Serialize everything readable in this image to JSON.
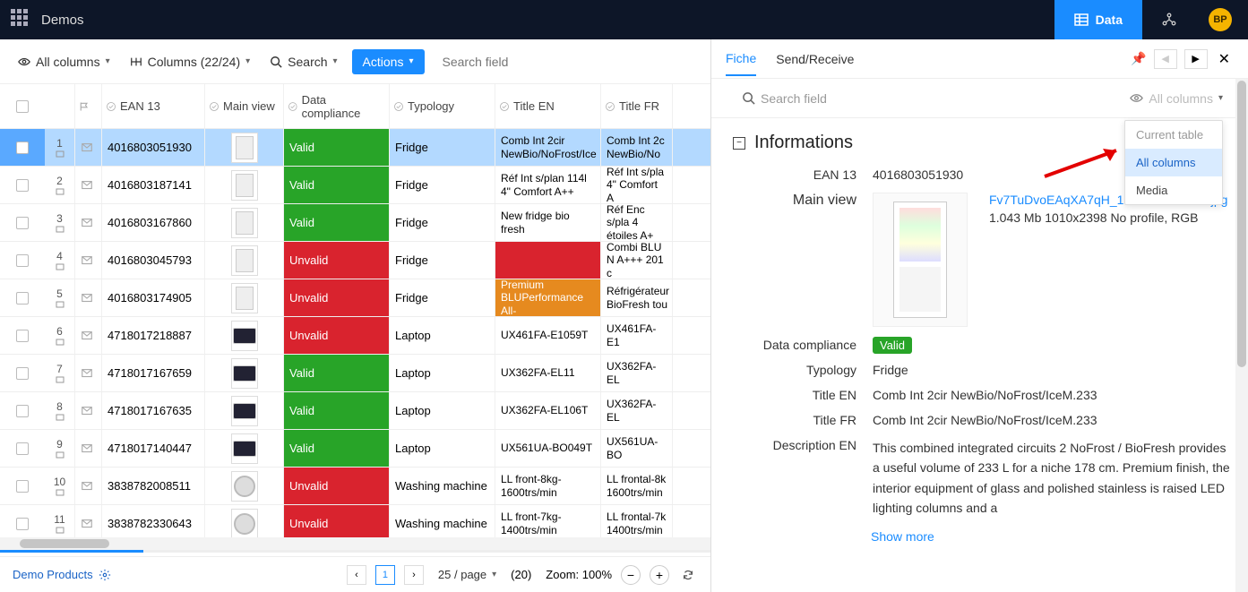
{
  "header": {
    "app": "Demos",
    "tabs": {
      "data": "Data"
    },
    "avatar": "BP"
  },
  "toolbar": {
    "allcols": "All columns",
    "columns": "Columns (22/24)",
    "search": "Search",
    "actions": "Actions",
    "search_ph": "Search field"
  },
  "grid_head": {
    "ean": "EAN 13",
    "main_view": "Main view",
    "compliance": "Data compliance",
    "typology": "Typology",
    "title_en": "Title EN",
    "title_fr": "Title FR"
  },
  "rows": [
    {
      "idx": "1",
      "ean": "4016803051930",
      "comp": "Valid",
      "typ": "Fridge",
      "en": "Comb Int 2cir NewBio/NoFrost/Ice",
      "fr": "Comb Int 2c NewBio/No",
      "thumb": "fridge",
      "sel": true
    },
    {
      "idx": "2",
      "ean": "4016803187141",
      "comp": "Valid",
      "typ": "Fridge",
      "en": "Réf Int s/plan 114l 4\" Comfort A++",
      "fr": "Réf Int s/pla 4\" Comfort A",
      "thumb": "fridge"
    },
    {
      "idx": "3",
      "ean": "4016803167860",
      "comp": "Valid",
      "typ": "Fridge",
      "en": "New fridge bio fresh",
      "fr": "Réf Enc s/pla 4 étoiles A+",
      "thumb": "fridge"
    },
    {
      "idx": "4",
      "ean": "4016803045793",
      "comp": "Unvalid",
      "typ": "Fridge",
      "en": "",
      "fr": "Combi BLU N A+++ 201 c",
      "thumb": "fridge",
      "en_bg": "red"
    },
    {
      "idx": "5",
      "ean": "4016803174905",
      "comp": "Unvalid",
      "typ": "Fridge",
      "en": "Premium BLUPerformance All-",
      "fr": "Réfrigérateur BioFresh tou",
      "thumb": "fridge",
      "en_bg": "orange"
    },
    {
      "idx": "6",
      "ean": "4718017218887",
      "comp": "Unvalid",
      "typ": "Laptop",
      "en": "UX461FA-E1059T",
      "fr": "UX461FA-E1",
      "thumb": "laptop"
    },
    {
      "idx": "7",
      "ean": "4718017167659",
      "comp": "Valid",
      "typ": "Laptop",
      "en": "UX362FA-EL11",
      "fr": "UX362FA-EL",
      "thumb": "laptop"
    },
    {
      "idx": "8",
      "ean": "4718017167635",
      "comp": "Valid",
      "typ": "Laptop",
      "en": "UX362FA-EL106T",
      "fr": "UX362FA-EL",
      "thumb": "laptop"
    },
    {
      "idx": "9",
      "ean": "4718017140447",
      "comp": "Valid",
      "typ": "Laptop",
      "en": "UX561UA-BO049T",
      "fr": "UX561UA-BO",
      "thumb": "laptop"
    },
    {
      "idx": "10",
      "ean": "3838782008511",
      "comp": "Unvalid",
      "typ": "Washing machine",
      "en": "LL front-8kg-1600trs/min",
      "fr": "LL frontal-8k 1600trs/min",
      "thumb": "wash"
    },
    {
      "idx": "11",
      "ean": "3838782330643",
      "comp": "Unvalid",
      "typ": "Washing machine",
      "en": "LL front-7kg-1400trs/min",
      "fr": "LL frontal-7k 1400trs/min",
      "thumb": "wash"
    }
  ],
  "footer": {
    "product": "Demo Products",
    "page": "1",
    "per_page": "25 / page",
    "total": "(20)",
    "zoom": "Zoom: 100%"
  },
  "right": {
    "tabs": {
      "fiche": "Fiche",
      "send": "Send/Receive"
    },
    "search_ph": "Search field",
    "all_cols": "All columns",
    "section": "Informations",
    "dropdown": {
      "current": "Current table",
      "all": "All columns",
      "media": "Media"
    },
    "fields": {
      "ean_l": "EAN 13",
      "ean_v": "4016803051930",
      "mv_l": "Main view",
      "img_link": "Fv7TuDvoEAqXA7qH_1625150426065.jpg",
      "img_meta": "1.043 Mb  1010x2398  No profile, RGB",
      "comp_l": "Data compliance",
      "comp_v": "Valid",
      "typ_l": "Typology",
      "typ_v": "Fridge",
      "ten_l": "Title EN",
      "ten_v": "Comb Int 2cir NewBio/NoFrost/IceM.233",
      "tfr_l": "Title FR",
      "tfr_v": "Comb Int 2cir NewBio/NoFrost/IceM.233",
      "den_l": "Description EN",
      "den_v": "This combined integrated circuits 2 NoFrost / BioFresh provides a useful volume of 233 L for a niche 178 cm. Premium finish, the interior equipment of glass and polished stainless is raised LED lighting columns and a",
      "show_more": "Show more"
    }
  }
}
